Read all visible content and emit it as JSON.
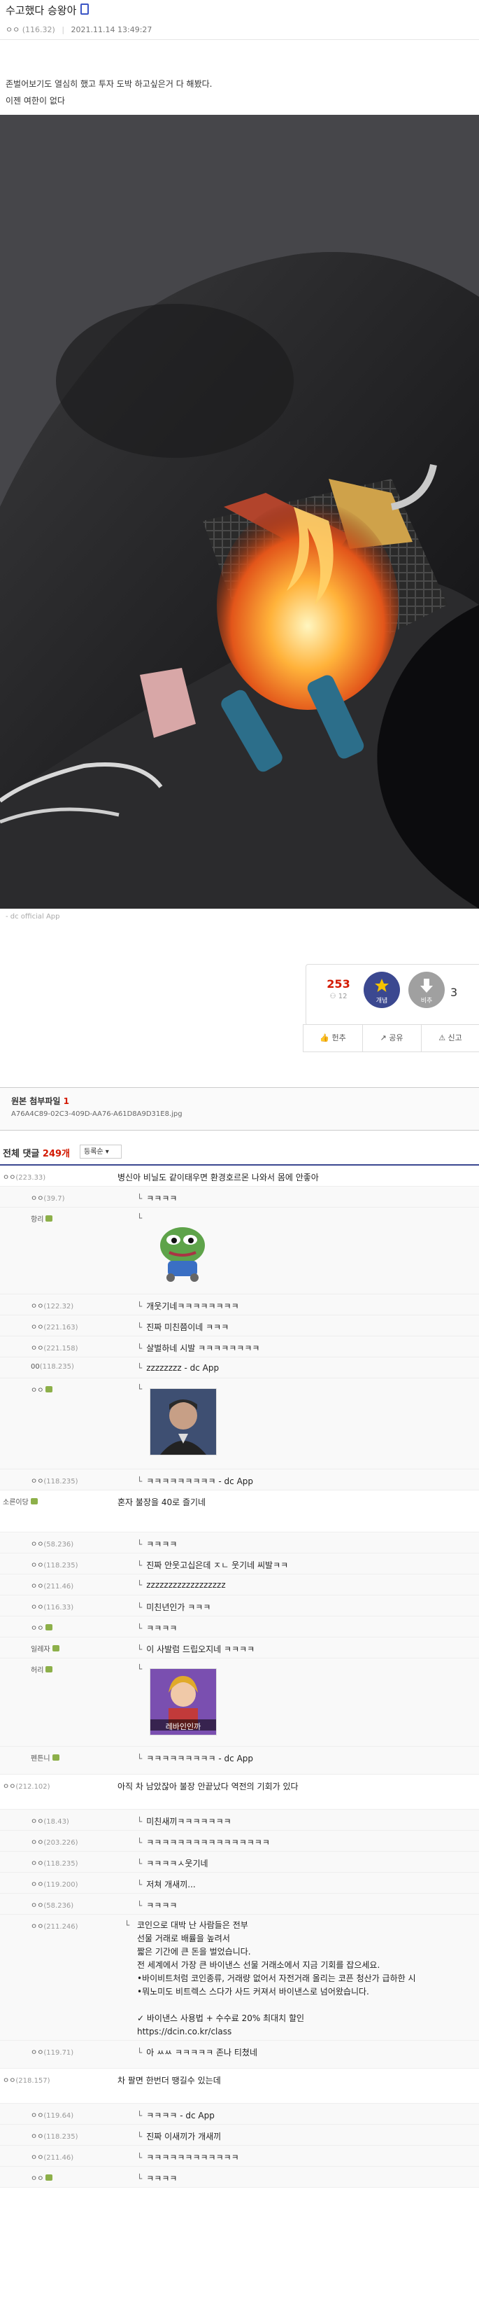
{
  "post": {
    "title": "수고했다 승왕아",
    "author_nick": "ㅇㅇ",
    "author_ip": "(116.32)",
    "date": "2021.11.14 13:49:27",
    "body_lines": [
      "존벌어보기도 열심히 했고 투자 도박 하고싶은거 다 해봤다.",
      "이젠 여한이 없다"
    ],
    "caption": "- dc official App"
  },
  "recommend": {
    "up_count": "253",
    "fixed_count": "12",
    "up_label": "개념",
    "down_label": "비추",
    "down_count": "3"
  },
  "share_bar": {
    "items": [
      "헌추",
      "공유",
      "신고"
    ]
  },
  "attachment": {
    "title": "원본 첨부파일",
    "count": "1",
    "file": "A76A4C89-02C3-409D-AA76-A61D8A9D31E8.jpg"
  },
  "comments_header": {
    "label": "전체 댓글",
    "count": "249개",
    "sort": "등록순"
  },
  "comments": [
    {
      "nick": "ㅇㅇ",
      "ip": "(223.33)",
      "text": "병신아 비닐도 같이태우면 환경호르몬 나와서 몸에 안좋아"
    },
    {
      "nick": "ㅇㅇ",
      "ip": "(39.7)",
      "text": "ㅋㅋㅋㅋ"
    },
    {
      "nick": "항리",
      "ip": "",
      "text": ""
    },
    {
      "nick": "ㅇㅇ",
      "ip": "(122.32)",
      "text": "개웃기네ㅋㅋㅋㅋㅋㅋㅋㅋ"
    },
    {
      "nick": "ㅇㅇ",
      "ip": "(221.163)",
      "text": "진짜 미친쯤이네 ㅋㅋㅋ"
    },
    {
      "nick": "ㅇㅇ",
      "ip": "(221.158)",
      "text": "살벌하네 시발 ㅋㅋㅋㅋㅋㅋㅋㅋ"
    },
    {
      "nick": "00",
      "ip": "(118.235)",
      "text": "zzzzzzzz - dc App"
    },
    {
      "nick": "ㅇㅇ",
      "ip": "",
      "text": ""
    },
    {
      "nick": "ㅇㅇ",
      "ip": "(118.235)",
      "text": "ㅋㅋㅋㅋㅋㅋㅋㅋㅋ - dc App"
    },
    {
      "nick": "소른이당",
      "ip": "",
      "text": "혼자 불장을 40로 즐기네"
    },
    {
      "nick": "ㅇㅇ",
      "ip": "(58.236)",
      "text": "ㅋㅋㅋㅋ"
    },
    {
      "nick": "ㅇㅇ",
      "ip": "(118.235)",
      "text": "진짜 안웃고십은데 ㅈㄴ 웃기네 씨발ㅋㅋ"
    },
    {
      "nick": "ㅇㅇ",
      "ip": "(211.46)",
      "text": "zzzzzzzzzzzzzzzzzz"
    },
    {
      "nick": "ㅇㅇ",
      "ip": "(116.33)",
      "text": "미친년인가 ㅋㅋㅋ"
    },
    {
      "nick": "ㅇㅇ",
      "ip": "",
      "text": "ㅋㅋㅋㅋ"
    },
    {
      "nick": "일레자",
      "ip": "",
      "text": "이 사발럼 드립오지네 ㅋㅋㅋㅋ"
    },
    {
      "nick": "허리",
      "ip": "",
      "text": ""
    },
    {
      "nick": "펜튼니",
      "ip": "",
      "text": "ㅋㅋㅋㅋㅋㅋㅋㅋㅋ - dc App"
    },
    {
      "nick": "ㅇㅇ",
      "ip": "(212.102)",
      "text": "아직 차 남았잖아 불장 안끝났다 역전의 기회가 있다"
    },
    {
      "nick": "ㅇㅇ",
      "ip": "(18.43)",
      "text": "미친새끼ㅋㅋㅋㅋㅋㅋㅋ"
    },
    {
      "nick": "ㅇㅇ",
      "ip": "(203.226)",
      "text": "ㅋㅋㅋㅋㅋㅋㅋㅋㅋㅋㅋㅋㅋㅋㅋㅋ"
    },
    {
      "nick": "ㅇㅇ",
      "ip": "(118.235)",
      "text": "ㅋㅋㅋㅋㅅ웃기네"
    },
    {
      "nick": "ㅇㅇ",
      "ip": "(119.200)",
      "text": "저쳐 개새끼..."
    },
    {
      "nick": "ㅇㅇ",
      "ip": "(58.236)",
      "text": "ㅋㅋㅋㅋ"
    },
    {
      "nick": "ㅇㅇ",
      "ip": "(211.246)",
      "text": "코인으로 대박 난 사람들은 전부\n선물 거래로 배률을 높려서\n짧은 기간에 큰 돈을 벌었습니다.\n전 세계에서 가장 큰 바이낸스 선물 거래소에서 지금 기회를 잡으세요.\n•바이비트처럼 코인종류, 거래량 없어서 자전거래 올리는 코픈 청산가 급하한 시\n•뭐노미도 비트렉스 스다가 사드 커져서 바이낸스로 넘어왔습니다.\n\n✓ 바이낸스 사용법 + 수수료 20% 최대치 할인\nhttps://dcin.co.kr/class"
    },
    {
      "nick": "ㅇㅇ",
      "ip": "(119.71)",
      "text": "아 ㅆㅆ ㅋㅋㅋㅋㅋ 존나 티쳤네"
    },
    {
      "nick": "ㅇㅇ",
      "ip": "(218.157)",
      "text": "차 팔면 한번더 땡길수 있는데"
    },
    {
      "nick": "ㅇㅇ",
      "ip": "(119.64)",
      "text": "ㅋㅋㅋㅋ - dc App"
    },
    {
      "nick": "ㅇㅇ",
      "ip": "(118.235)",
      "text": "진짜 이새끼가 개새끼"
    },
    {
      "nick": "ㅇㅇ",
      "ip": "(211.46)",
      "text": "ㅋㅋㅋㅋㅋㅋㅋㅋㅋㅋㅋㅋ"
    },
    {
      "nick": "ㅇㅇ",
      "ip": "",
      "text": "ㅋㅋㅋㅋ"
    }
  ],
  "sticker_text": "레바인인까"
}
